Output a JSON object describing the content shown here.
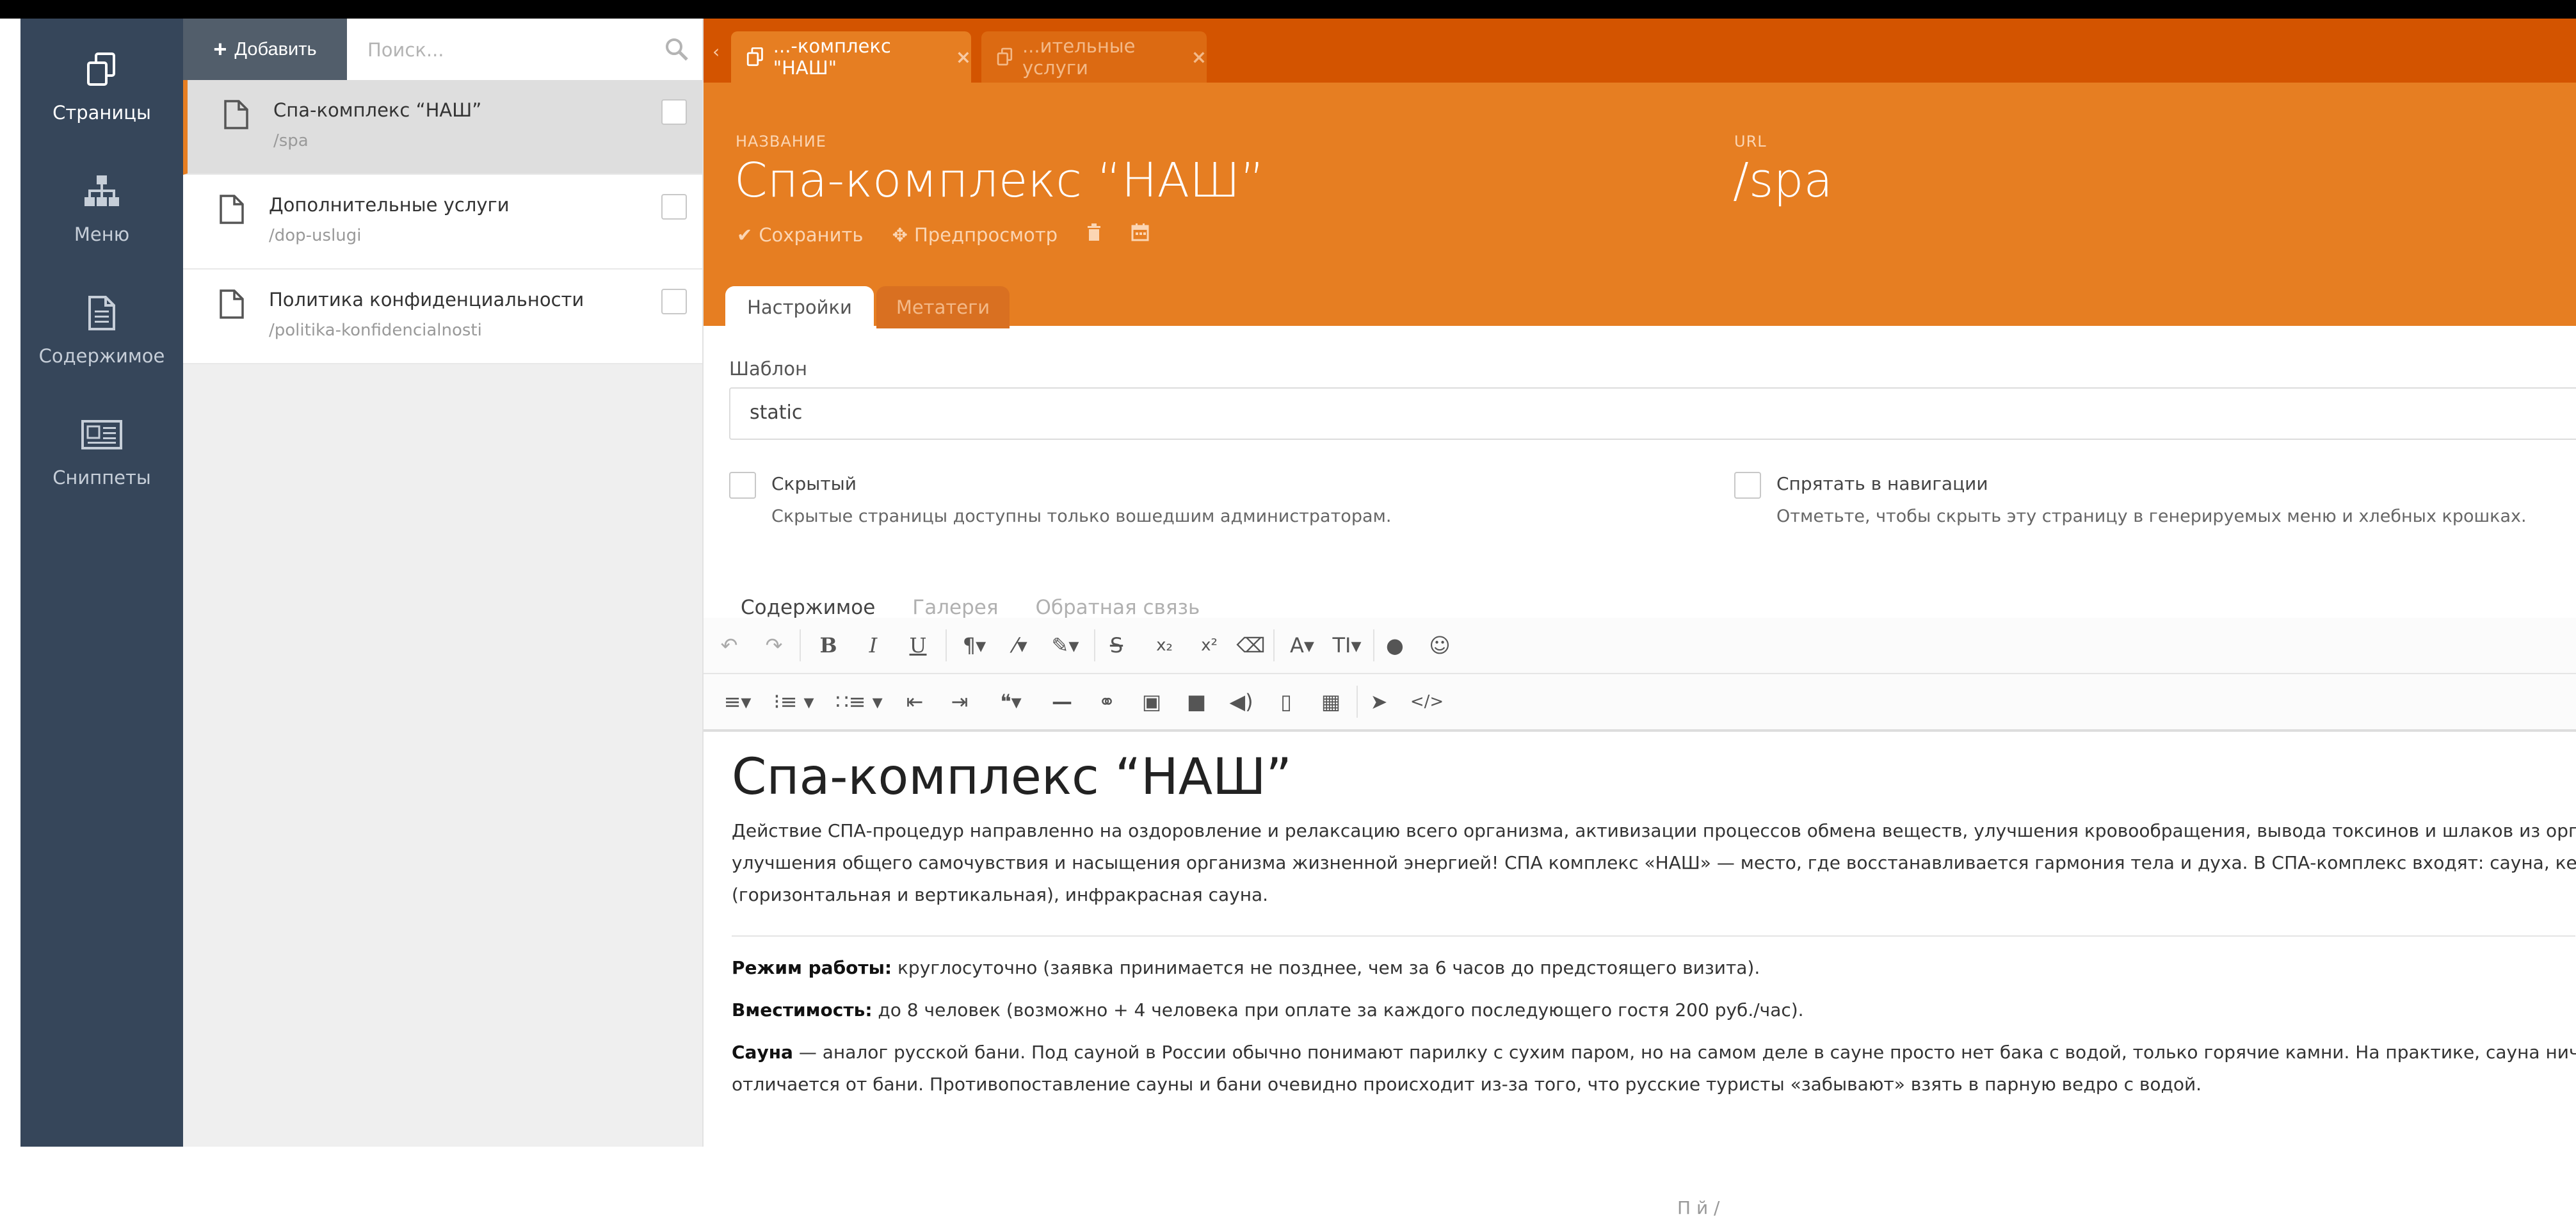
{
  "nav": {
    "items": [
      {
        "label": "Страницы",
        "icon": "pages-icon",
        "active": true
      },
      {
        "label": "Меню",
        "icon": "sitemap-icon"
      },
      {
        "label": "Содержимое",
        "icon": "document-icon"
      },
      {
        "label": "Сниппеты",
        "icon": "snippets-icon"
      }
    ]
  },
  "list": {
    "add_label": "Добавить",
    "search_placeholder": "Поиск...",
    "pages": [
      {
        "title": "Спа-комплекс “НАШ”",
        "slug": "/spa"
      },
      {
        "title": "Дополнительные услуги",
        "slug": "/dop-uslugi"
      },
      {
        "title": "Политика конфиденциальности",
        "slug": "/politika-konfidencialnosti"
      }
    ]
  },
  "tabs": [
    {
      "label": "...-комплекс \"НАШ\""
    },
    {
      "label": "...ительные услуги"
    }
  ],
  "header": {
    "name_caption": "НАЗВАНИЕ",
    "name_value": "Спа-комплекс “НАШ”",
    "url_caption": "URL",
    "url_value": "/spa",
    "save_label": "Сохранить",
    "preview_label": "Предпросмотр"
  },
  "subtabs": {
    "settings": "Настройки",
    "meta": "Метатеги"
  },
  "form": {
    "template_label": "Шаблон",
    "template_value": "static",
    "hidden_label": "Скрытый",
    "hidden_help": "Скрытые страницы доступны только вошедшим администраторам.",
    "hide_nav_label": "Спрятать в навигации",
    "hide_nav_help": "Отметьте, чтобы скрыть эту страницу в генерируемых меню и хлебных крошках."
  },
  "content_tabs": [
    "Содержимое",
    "Галерея",
    "Обратная связь"
  ],
  "content": {
    "heading": "Спа-комплекс “НАШ”",
    "para_lines": [
      "Действие СПА-процедур направленно на оздоровление и релаксацию всего организма, активизации процессов обмена веществ, улучшения кровообращения, вывода токсинов и шлаков из организма,",
      "улучшения общего самочувствия и насыщения организма жизненной энергией! СПА комплекс «НАШ» — место, где восстанавливается гармония тела и духа. В СПА-комплекс входят: сауна, кедровые боч",
      "(горизонтальная и вертикальная), инфракрасная сауна."
    ],
    "hours_label": "Режим работы:",
    "hours_text": " круглосуточно (заявка принимается не позднее, чем за 6 часов до предстоящего визита).",
    "capacity_label": "Вместимость:",
    "capacity_text": " до 8 человек (возможно + 4 человека при оплате за каждого последующего гостя 200 руб./час).",
    "sauna_label": "Сауна",
    "sauna_line1": " — аналог русской бани. Под сауной в России обычно понимают парилку с сухим паром, но на самом деле в сауне просто нет бака с водой, только горячие камни. На практике, сауна ничем не",
    "sauna_line2": "отличается от бани. Противопоставление сауны и бани очевидно происходит из-за того, что русские туристы «забывают» взять в парную ведро с водой."
  },
  "footer_fragment": "П                                         й                   /"
}
